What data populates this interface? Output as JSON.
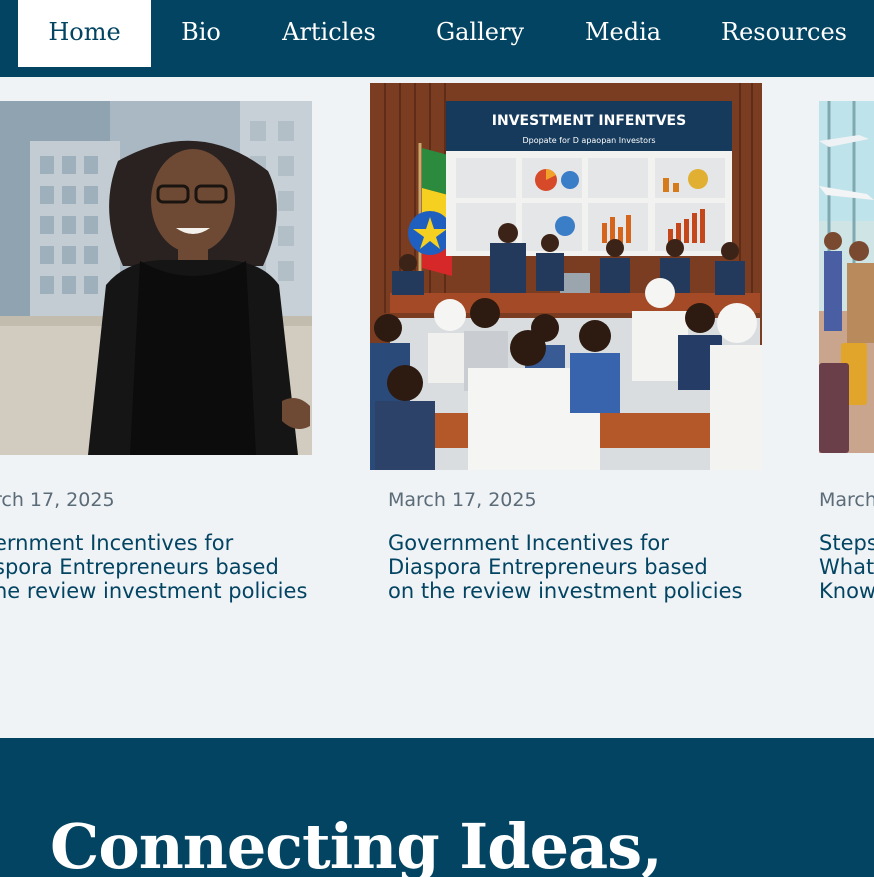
{
  "nav": {
    "items": [
      {
        "label": "Home",
        "active": true
      },
      {
        "label": "Bio",
        "active": false
      },
      {
        "label": "Articles",
        "active": false
      },
      {
        "label": "Gallery",
        "active": false
      },
      {
        "label": "Media",
        "active": false
      },
      {
        "label": "Resources",
        "active": false
      }
    ]
  },
  "cards": [
    {
      "date": "rch 17, 2025",
      "title_lines": [
        "ernment Incentives for",
        "spora Entrepreneurs based",
        "he review investment policies"
      ]
    },
    {
      "image_heading": "INVESTMENT INFENTVES",
      "image_subheading": "Dpopate for D apaopan Investors",
      "date": "March 17, 2025",
      "title_lines": [
        "Government Incentives for",
        "Diaspora Entrepreneurs based",
        "on the review investment policies"
      ]
    },
    {
      "date": "March",
      "title_lines": [
        "Steps",
        "What",
        "Know"
      ]
    }
  ],
  "footer": {
    "heading": "Connecting Ideas,"
  },
  "colors": {
    "nav_bg": "#034462",
    "page_bg": "#eff3f6",
    "title_text": "#034462",
    "date_text": "#5b6b77"
  }
}
